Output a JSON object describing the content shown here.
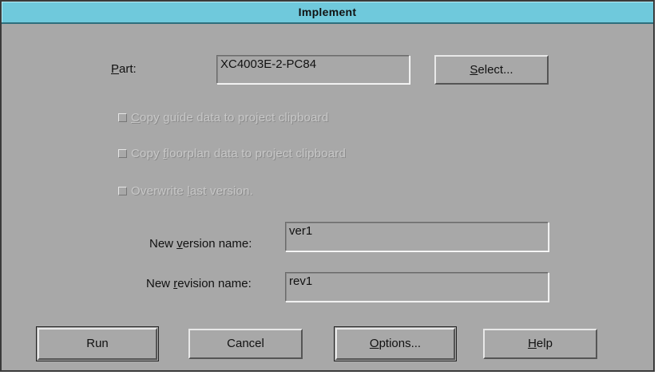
{
  "window": {
    "title": "Implement"
  },
  "part": {
    "label_prefix": "",
    "label_hotkey": "P",
    "label_rest": "art:",
    "value": "XC4003E-2-PC84",
    "select_hotkey": "S",
    "select_rest": "elect..."
  },
  "checkboxes": [
    {
      "hotkey": "C",
      "rest": "opy guide data to project clipboard",
      "prefix": "",
      "checked": false,
      "enabled": false
    },
    {
      "prefix": "Copy ",
      "hotkey": "f",
      "rest": "loorplan data to project clipboard",
      "checked": false,
      "enabled": false
    },
    {
      "prefix": "Overwrite ",
      "hotkey": "l",
      "rest": "ast version.",
      "checked": false,
      "enabled": false
    }
  ],
  "version": {
    "label_prefix": "New ",
    "label_hotkey": "v",
    "label_rest": "ersion name:",
    "value": "ver1"
  },
  "revision": {
    "label_prefix": "New ",
    "label_hotkey": "r",
    "label_rest": "evision name:",
    "value": "rev1"
  },
  "buttons": {
    "run": "Run",
    "cancel": "Cancel",
    "options_hotkey": "O",
    "options_rest": "ptions...",
    "help_hotkey": "H",
    "help_rest": "elp"
  },
  "colors": {
    "titlebar": "#6fc9dc",
    "dialog_bg": "#a8a8a8",
    "disabled_text": "#c8c8c8"
  }
}
